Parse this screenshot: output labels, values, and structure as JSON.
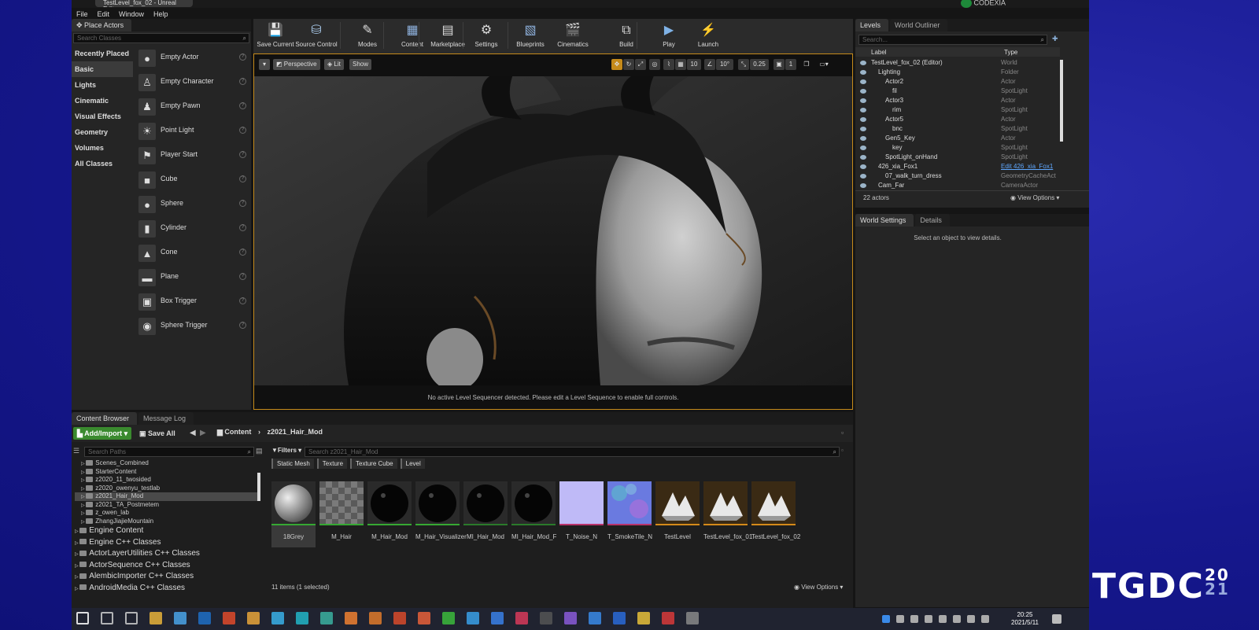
{
  "window": {
    "title": "TestLevel_fox_02 - Unreal Editor"
  },
  "menu": [
    "File",
    "Edit",
    "Window",
    "Help"
  ],
  "codexia": "CODEXIA",
  "place_actors": {
    "tab": "Place Actors",
    "search_placeholder": "Search Classes",
    "categories": [
      "Recently Placed",
      "Basic",
      "Lights",
      "Cinematic",
      "Visual Effects",
      "Geometry",
      "Volumes",
      "All Classes"
    ],
    "selected_category": "Basic",
    "items": [
      {
        "label": "Empty Actor",
        "icon": "sphere-icon"
      },
      {
        "label": "Empty Character",
        "icon": "character-icon"
      },
      {
        "label": "Empty Pawn",
        "icon": "pawn-icon"
      },
      {
        "label": "Point Light",
        "icon": "light-bulb-icon"
      },
      {
        "label": "Player Start",
        "icon": "player-start-icon"
      },
      {
        "label": "Cube",
        "icon": "cube-icon"
      },
      {
        "label": "Sphere",
        "icon": "sphere-icon"
      },
      {
        "label": "Cylinder",
        "icon": "cylinder-icon"
      },
      {
        "label": "Cone",
        "icon": "cone-icon"
      },
      {
        "label": "Plane",
        "icon": "plane-icon"
      },
      {
        "label": "Box Trigger",
        "icon": "box-trigger-icon"
      },
      {
        "label": "Sphere Trigger",
        "icon": "sphere-trigger-icon"
      }
    ]
  },
  "toolbar": {
    "buttons": [
      {
        "label": "Save Current",
        "icon": "save-icon"
      },
      {
        "label": "Source Control",
        "icon": "source-control-icon"
      },
      {
        "label": "Modes",
        "icon": "modes-icon"
      },
      {
        "label": "Content",
        "icon": "content-icon"
      },
      {
        "label": "Marketplace",
        "icon": "marketplace-icon"
      },
      {
        "label": "Settings",
        "icon": "settings-icon"
      },
      {
        "label": "Blueprints",
        "icon": "blueprints-icon"
      },
      {
        "label": "Cinematics",
        "icon": "cinematics-icon"
      },
      {
        "label": "Build",
        "icon": "build-icon"
      },
      {
        "label": "Play",
        "icon": "play-icon"
      },
      {
        "label": "Launch",
        "icon": "launch-icon"
      }
    ]
  },
  "viewport": {
    "perspective": "Perspective",
    "lit": "Lit",
    "show": "Show",
    "grid_snap": "10",
    "rot_snap": "10°",
    "scale_snap": "0.25",
    "camera_speed": "1",
    "message": "No active Level Sequencer detected. Please edit a Level Sequence to enable full controls."
  },
  "outliner": {
    "tabs": [
      "Levels",
      "World Outliner"
    ],
    "search_placeholder": "Search...",
    "col_label": "Label",
    "col_type": "Type",
    "rows": [
      {
        "label": "TestLevel_fox_02 (Editor)",
        "type": "World",
        "indent": 0
      },
      {
        "label": "Lighting",
        "type": "Folder",
        "indent": 1
      },
      {
        "label": "Actor2",
        "type": "Actor",
        "indent": 2
      },
      {
        "label": "fil",
        "type": "SpotLight",
        "indent": 3
      },
      {
        "label": "Actor3",
        "type": "Actor",
        "indent": 2
      },
      {
        "label": "rim",
        "type": "SpotLight",
        "indent": 3
      },
      {
        "label": "Actor5",
        "type": "Actor",
        "indent": 2
      },
      {
        "label": "bnc",
        "type": "SpotLight",
        "indent": 3
      },
      {
        "label": "Gen5_Key",
        "type": "Actor",
        "indent": 2
      },
      {
        "label": "key",
        "type": "SpotLight",
        "indent": 3
      },
      {
        "label": "SpotLight_onHand",
        "type": "SpotLight",
        "indent": 2
      },
      {
        "label": "426_xia_Fox1",
        "type": "Edit 426_xia_Fox1",
        "indent": 1
      },
      {
        "label": "07_walk_turn_dress",
        "type": "GeometryCacheAct",
        "indent": 2
      },
      {
        "label": "Cam_Far",
        "type": "CameraActor",
        "indent": 1
      }
    ],
    "count": "22 actors",
    "view_options": "View Options"
  },
  "details": {
    "tabs": [
      "World Settings",
      "Details"
    ],
    "empty_message": "Select an object to view details."
  },
  "content_browser": {
    "tabs": [
      "Content Browser",
      "Message Log"
    ],
    "add_import": "Add/Import",
    "save_all": "Save All",
    "breadcrumb": [
      "Content",
      "z2021_Hair_Mod"
    ],
    "paths_placeholder": "Search Paths",
    "filters": "Filters",
    "search_placeholder": "Search z2021_Hair_Mod",
    "filter_chips": [
      "Static Mesh",
      "Texture",
      "Texture Cube",
      "Level"
    ],
    "tree": [
      {
        "label": "Scenes_Combined",
        "indent": 1
      },
      {
        "label": "StarterContent",
        "indent": 1
      },
      {
        "label": "z2020_11_twosided",
        "indent": 1
      },
      {
        "label": "z2020_owenyu_testlab",
        "indent": 1
      },
      {
        "label": "z2021_Hair_Mod",
        "indent": 1,
        "selected": true
      },
      {
        "label": "z2021_TA_Postmetem",
        "indent": 1
      },
      {
        "label": "z_owen_lab",
        "indent": 1
      },
      {
        "label": "ZhangJiajieMountain",
        "indent": 1
      },
      {
        "label": "Engine Content",
        "indent": 0,
        "big": true
      },
      {
        "label": "Engine C++ Classes",
        "indent": 0,
        "big": true
      },
      {
        "label": "ActorLayerUtilities C++ Classes",
        "indent": 0,
        "big": true
      },
      {
        "label": "ActorSequence C++ Classes",
        "indent": 0,
        "big": true
      },
      {
        "label": "AlembicImporter C++ Classes",
        "indent": 0,
        "big": true
      },
      {
        "label": "AndroidMedia C++ Classes",
        "indent": 0,
        "big": true
      }
    ],
    "assets": [
      {
        "name": "18Grey",
        "kind": "sphere-grey",
        "bar": "#36a833"
      },
      {
        "name": "M_Hair",
        "kind": "checker",
        "bar": "#36a833"
      },
      {
        "name": "M_Hair_Mod",
        "kind": "sphere-black",
        "bar": "#36a833"
      },
      {
        "name": "M_Hair_Visualizer",
        "kind": "sphere-black",
        "bar": "#36a833"
      },
      {
        "name": "MI_Hair_Mod",
        "kind": "sphere-black",
        "bar": "#2a7a2a"
      },
      {
        "name": "MI_Hair_Mod_F",
        "kind": "sphere-black",
        "bar": "#2a7a2a"
      },
      {
        "name": "T_Noise_N",
        "kind": "noise",
        "bar": "#b8326a"
      },
      {
        "name": "T_SmokeTile_N",
        "kind": "smoke",
        "bar": "#b8326a"
      },
      {
        "name": "TestLevel",
        "kind": "level",
        "bar": "#d48a1a"
      },
      {
        "name": "TestLevel_fox_01",
        "kind": "level",
        "bar": "#d48a1a"
      },
      {
        "name": "TestLevel_fox_02",
        "kind": "level",
        "bar": "#d48a1a"
      }
    ],
    "status": "11 items (1 selected)",
    "view_options": "View Options"
  },
  "taskbar": {
    "time": "20:25",
    "date": "2021/5/11"
  },
  "branding": {
    "logo": "TGDC",
    "year_top": "20",
    "year_bottom": "21"
  },
  "colors": {
    "accent": "#c58a1a",
    "ue_bg": "#151515",
    "backdrop": "#15168d"
  }
}
